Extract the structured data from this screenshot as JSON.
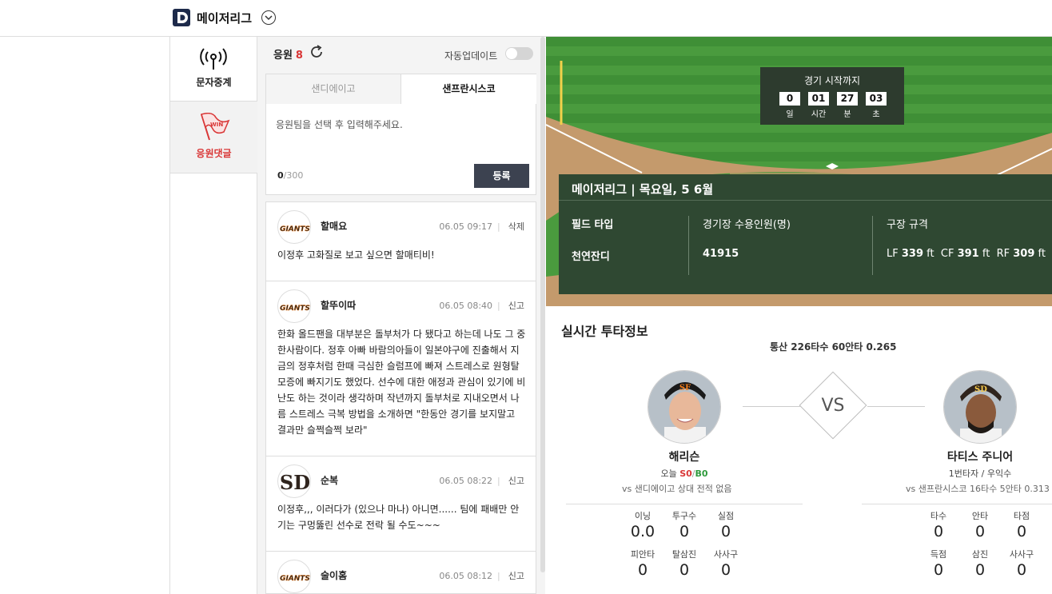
{
  "header": {
    "brand": "메이저리그"
  },
  "nav": [
    {
      "label": "문자중계",
      "icon": "broadcast-icon"
    },
    {
      "label": "응원댓글",
      "icon": "win-flag-icon"
    }
  ],
  "cheer": {
    "title": "응원",
    "count": "8",
    "auto_update_label": "자동업데이트",
    "tabs": [
      "샌디에이고",
      "샌프란시스코"
    ],
    "placeholder": "응원팀을 선택 후 입력해주세요.",
    "char_count": "0",
    "char_max": "/300",
    "submit_label": "등록",
    "comments": [
      {
        "team": "SF",
        "name": "할매요",
        "time": "06.05 09:17",
        "action": "삭제",
        "text": "이정후 고화질로 보고 싶으면 할매티비!"
      },
      {
        "team": "SF",
        "name": "할뚜이따",
        "time": "06.05 08:40",
        "action": "신고",
        "text": "한화 올드팬을 대부분은 돌부처가 다 됐다고 하는데 나도 그 중 한사람이다. 정후 아빠 바람의아들이 일본야구에 진출해서 지금의 정후처럼 한때 극심한 슬럼프에 빠져 스트레스로 원형탈모증에 빠지기도 했었다. 선수에 대한 애정과 관심이 있기에 비난도 하는 것이라 생각하며 작년까지 돌부처로 지내오면서 나름 스트레스 극복 방법을 소개하면 \"한동안 경기를 보지말고 결과만 슬쩍슬쩍 보라\""
      },
      {
        "team": "SD",
        "name": "순복",
        "time": "06.05 08:22",
        "action": "신고",
        "text": "이정후,,, 이러다가 (있으나 마나) 아니면...... 팀에 패배만 안기는 구멍뚫린 선수로 전락 될 수도~~~"
      },
      {
        "team": "SF",
        "name": "술이홈",
        "time": "06.05 08:12",
        "action": "신고",
        "text": ""
      }
    ]
  },
  "countdown": {
    "title": "경기 시작까지",
    "items": [
      {
        "num": "0",
        "unit": "일"
      },
      {
        "num": "01",
        "unit": "시간"
      },
      {
        "num": "27",
        "unit": "분"
      },
      {
        "num": "03",
        "unit": "초"
      }
    ]
  },
  "stadium": {
    "title": "메이저리그 | 목요일, 5 6월",
    "field_type_label": "필드 타입",
    "field_type": "천연잔디",
    "capacity_label": "경기장 수용인원(명)",
    "capacity": "41915",
    "dims_label": "구장 규격",
    "lf_label": "LF",
    "lf": "339",
    "cf_label": "CF",
    "cf": "391",
    "rf_label": "RF",
    "rf": "309",
    "unit": "ft"
  },
  "live": {
    "title": "실시간 투타정보",
    "summary": "통산 226타수 60안타 0.265",
    "vs": "VS",
    "pitcher": {
      "name": "해리슨",
      "today_label": "오늘",
      "s": "S0",
      "sep": "/",
      "b": "B0",
      "vs": "vs 샌디에이고   상대 전적 없음",
      "stats": [
        {
          "h": "이닝",
          "n": "0.0"
        },
        {
          "h": "투구수",
          "n": "0"
        },
        {
          "h": "실점",
          "n": "0"
        },
        {
          "h": "피안타",
          "n": "0"
        },
        {
          "h": "탈삼진",
          "n": "0"
        },
        {
          "h": "사사구",
          "n": "0"
        }
      ]
    },
    "batter": {
      "name": "타티스 주니어",
      "info": "1번타자 / 우익수",
      "vs": "vs 샌프란시스코   16타수 5안타 0.313",
      "stats": [
        {
          "h": "타수",
          "n": "0"
        },
        {
          "h": "안타",
          "n": "0"
        },
        {
          "h": "타점",
          "n": "0"
        },
        {
          "h": "득점",
          "n": "0"
        },
        {
          "h": "삼진",
          "n": "0"
        },
        {
          "h": "사사구",
          "n": "0"
        }
      ]
    }
  },
  "colors": {
    "accent_red": "#d93636",
    "field_green": "#3d8f35",
    "info_green": "#2f4832",
    "dark_button": "#3c4250"
  }
}
